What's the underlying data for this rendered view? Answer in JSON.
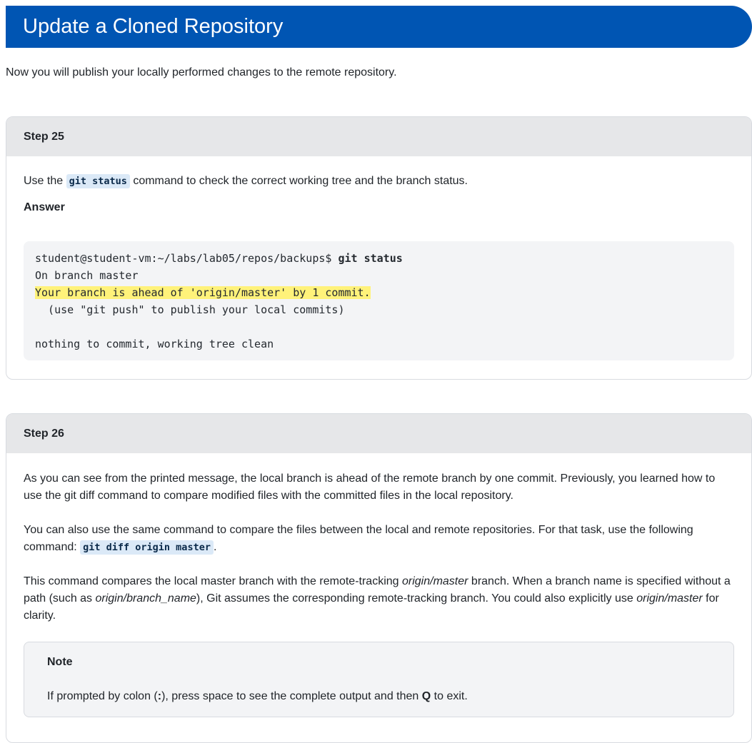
{
  "page": {
    "title": "Update a Cloned Repository",
    "intro": "Now you will publish your locally performed changes to the remote repository."
  },
  "step25": {
    "heading": "Step 25",
    "text_before": "Use the ",
    "command": "git status",
    "text_after": " command to check the correct working tree and the branch status.",
    "answer_label": "Answer",
    "terminal": {
      "prompt": "student@student-vm:~/labs/lab05/repos/backups$ ",
      "command": "git status",
      "line1": "On branch master",
      "line2": "Your branch is ahead of 'origin/master' by 1 commit.",
      "line3": "  (use \"git push\" to publish your local commits)",
      "line4": "nothing to commit, working tree clean"
    }
  },
  "step26": {
    "heading": "Step 26",
    "para1": "As you can see from the printed message, the local branch is ahead of the remote branch by one commit. Previously, you learned how to use the git diff command to compare modified files with the committed files in the local repository.",
    "para2_before": "You can also use the same command to compare the files between the local and remote repositories. For that task, use the following command: ",
    "para2_command": "git diff origin master",
    "para2_after": ".",
    "para3_a": "This command compares the local master branch with the remote-tracking ",
    "para3_b": "origin/master",
    "para3_c": " branch. When a branch name is specified without a path (such as ",
    "para3_d": "origin/branch_name",
    "para3_e": "), Git assumes the corresponding remote-tracking branch. You could also explicitly use ",
    "para3_f": "origin/master",
    "para3_g": " for clarity.",
    "note": {
      "title": "Note",
      "text_a": "If prompted by colon (",
      "text_b": ":",
      "text_c": "), press space to see the complete output and then ",
      "text_d": "Q",
      "text_e": " to exit."
    }
  },
  "colors": {
    "banner": "#0055b3",
    "highlight": "#fff27a",
    "inline_code_bg": "#dbe9f7"
  }
}
